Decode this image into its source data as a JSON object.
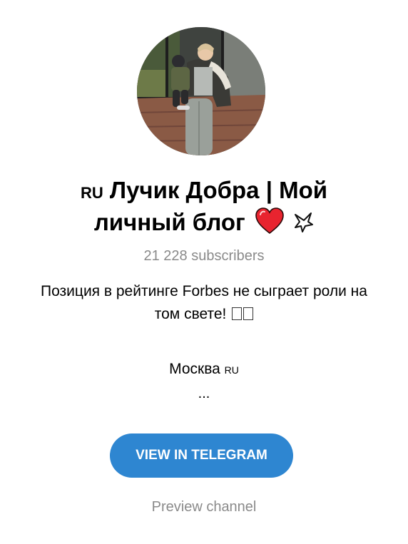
{
  "channel": {
    "title_flag": "RU",
    "title_line1": "Лучик Добра | Мой",
    "title_line2": "личный блог",
    "heart_icon": "red-heart-icon",
    "dove_icon": "dove-icon",
    "subscribers": "21 228 subscribers",
    "description_line1": "Позиция в рейтинге Forbes не сыграет роли на",
    "description_line2": "том свете!",
    "location": "Москва",
    "location_flag": "RU",
    "more": "..."
  },
  "actions": {
    "view_button": "VIEW IN TELEGRAM",
    "preview_link": "Preview channel"
  },
  "colors": {
    "button": "#2e86d1",
    "muted_text": "#8a8a8a"
  }
}
